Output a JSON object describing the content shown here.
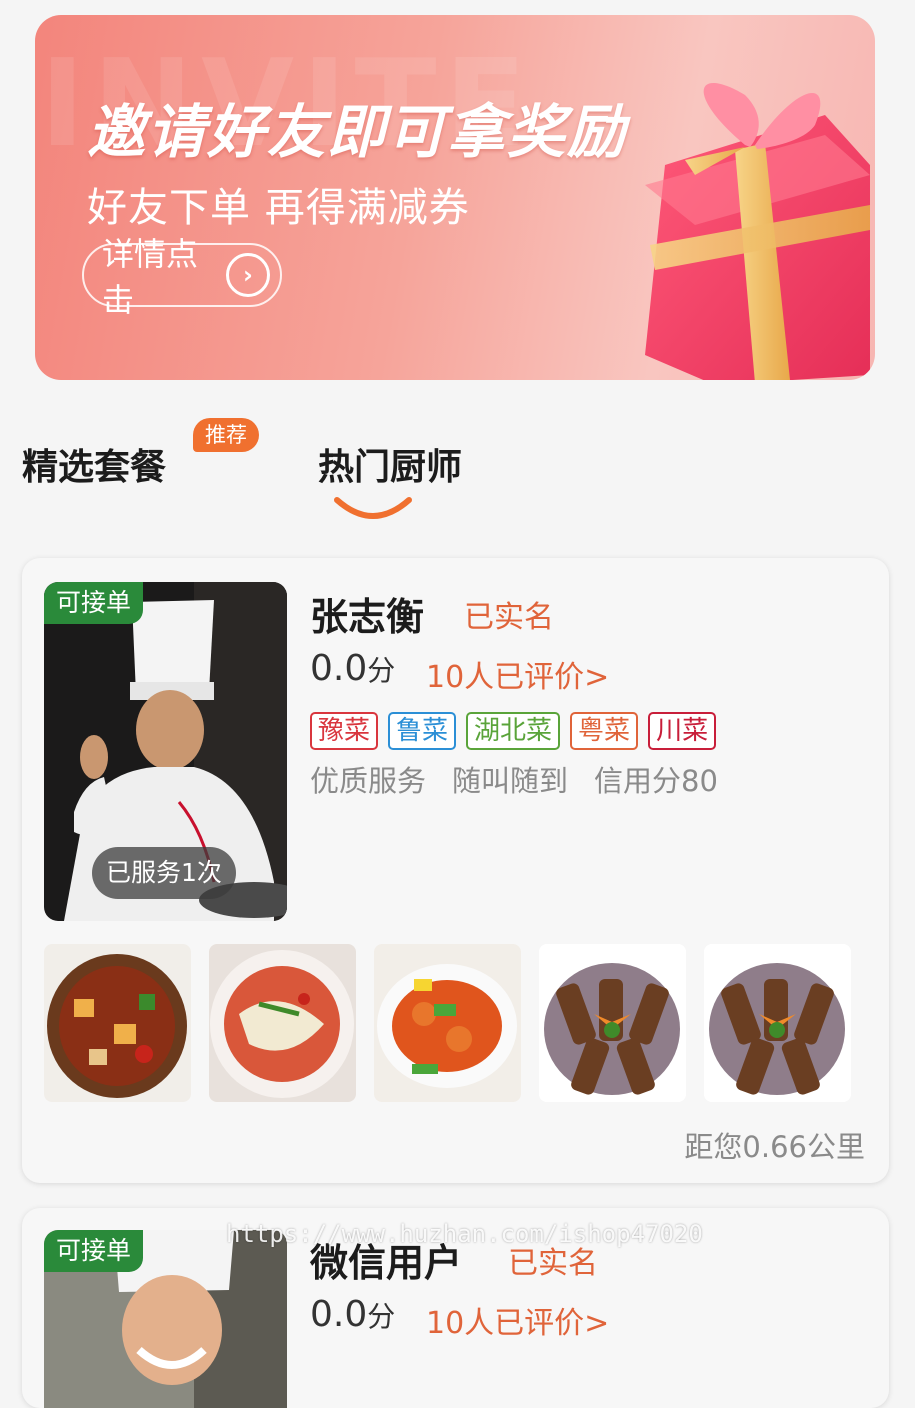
{
  "banner": {
    "bg_word": "INVITE",
    "title": "邀请好友即可拿奖励",
    "subtitle": "好友下单 再得满减券",
    "button_label": "详情点击"
  },
  "tabs": {
    "tab1_label": "精选套餐",
    "tab1_badge": "推荐",
    "tab2_label": "热门厨师"
  },
  "chefs": [
    {
      "status_badge": "可接单",
      "served": "已服务1次",
      "name": "张志衡",
      "verified": "已实名",
      "score": "0.0",
      "score_unit": "分",
      "reviews": "10人已评价>",
      "tags": [
        {
          "label": "豫菜",
          "color": "#d9363e"
        },
        {
          "label": "鲁菜",
          "color": "#2b8fd6"
        },
        {
          "label": "湖北菜",
          "color": "#5aa43a"
        },
        {
          "label": "粤菜",
          "color": "#e0643a"
        },
        {
          "label": "川菜",
          "color": "#c81e3a"
        }
      ],
      "features": [
        "优质服务",
        "随叫随到",
        "信用分80"
      ],
      "distance": "距您0.66公里"
    },
    {
      "status_badge": "可接单",
      "name": "微信用户",
      "verified": "已实名",
      "score": "0.0",
      "score_unit": "分",
      "reviews": "10人已评价>"
    }
  ],
  "watermark": "https://www.huzhan.com/ishop47020",
  "colors": {
    "accent": "#f0702f",
    "verified": "#e0643a",
    "badge_green": "#2a8a3a"
  }
}
